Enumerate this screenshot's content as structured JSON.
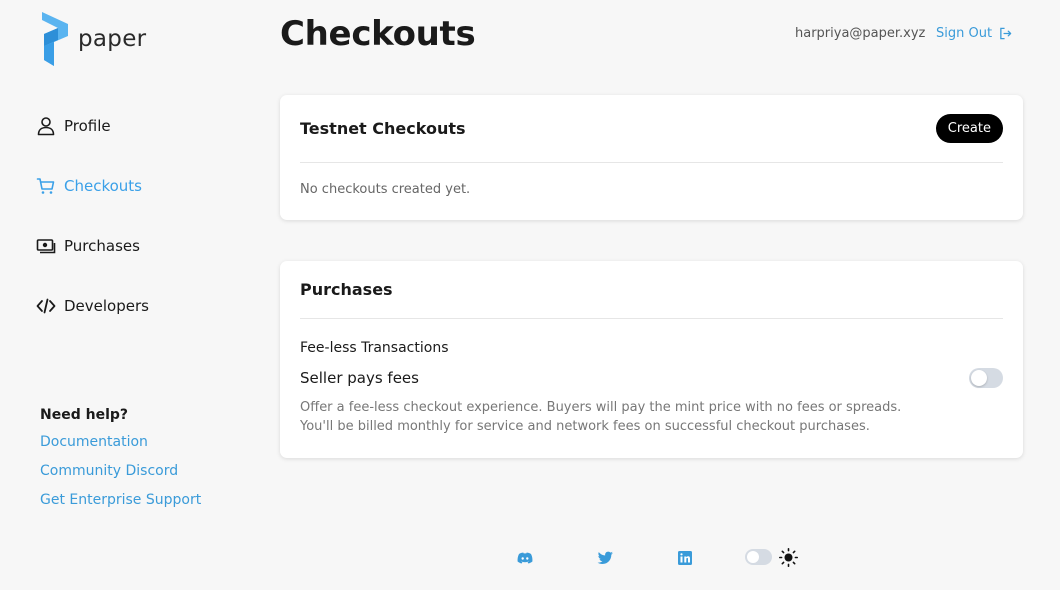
{
  "brand": {
    "name": "paper"
  },
  "sidebar": {
    "items": [
      {
        "label": "Profile",
        "icon": "user-icon"
      },
      {
        "label": "Checkouts",
        "icon": "cart-icon",
        "active": true
      },
      {
        "label": "Purchases",
        "icon": "money-icon"
      },
      {
        "label": "Developers",
        "icon": "code-icon"
      }
    ],
    "help": {
      "title": "Need help?",
      "links": [
        "Documentation",
        "Community Discord",
        "Get Enterprise Support"
      ]
    }
  },
  "header": {
    "title": "Checkouts",
    "email": "harpriya@paper.xyz",
    "signout_label": "Sign Out"
  },
  "testnet_card": {
    "title": "Testnet Checkouts",
    "create_label": "Create",
    "empty_text": "No checkouts created yet."
  },
  "purchases_card": {
    "title": "Purchases",
    "section_label": "Fee-less Transactions",
    "toggle_label": "Seller pays fees",
    "toggle_on": false,
    "description_line1": "Offer a fee-less checkout experience. Buyers will pay the mint price with no fees or spreads.",
    "description_line2": "You'll be billed monthly for service and network fees on successful checkout purchases."
  },
  "footer": {
    "icons": [
      "discord-icon",
      "twitter-icon",
      "linkedin-icon"
    ],
    "theme": "light"
  },
  "colors": {
    "accent": "#3aa0e8",
    "link": "#3a9bd9",
    "background": "#f7f7f7",
    "button": "#000000"
  }
}
